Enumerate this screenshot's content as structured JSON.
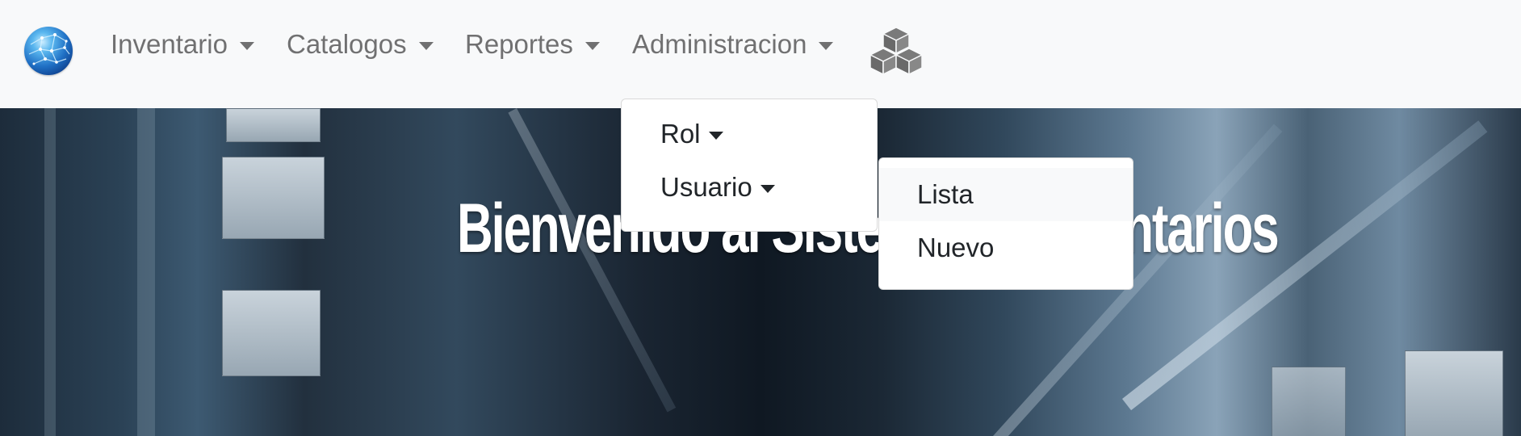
{
  "navbar": {
    "logo_icon": "globe-icon",
    "items": [
      {
        "label": "Inventario"
      },
      {
        "label": "Catalogos"
      },
      {
        "label": "Reportes"
      },
      {
        "label": "Administracion"
      }
    ],
    "cubes_icon": "cubes-icon"
  },
  "hero": {
    "title": "Bienvenido al Sistema de Inventarios"
  },
  "admin_menu": {
    "items": [
      {
        "label": "Rol"
      },
      {
        "label": "Usuario"
      }
    ]
  },
  "usuario_submenu": {
    "items": [
      {
        "label": "Lista"
      },
      {
        "label": "Nuevo"
      }
    ]
  },
  "colors": {
    "navbar_bg": "#f8f9fa",
    "nav_text": "#7f8081",
    "dropdown_bg": "#ffffff",
    "dropdown_text": "#212529",
    "hero_title": "#ffffff"
  }
}
